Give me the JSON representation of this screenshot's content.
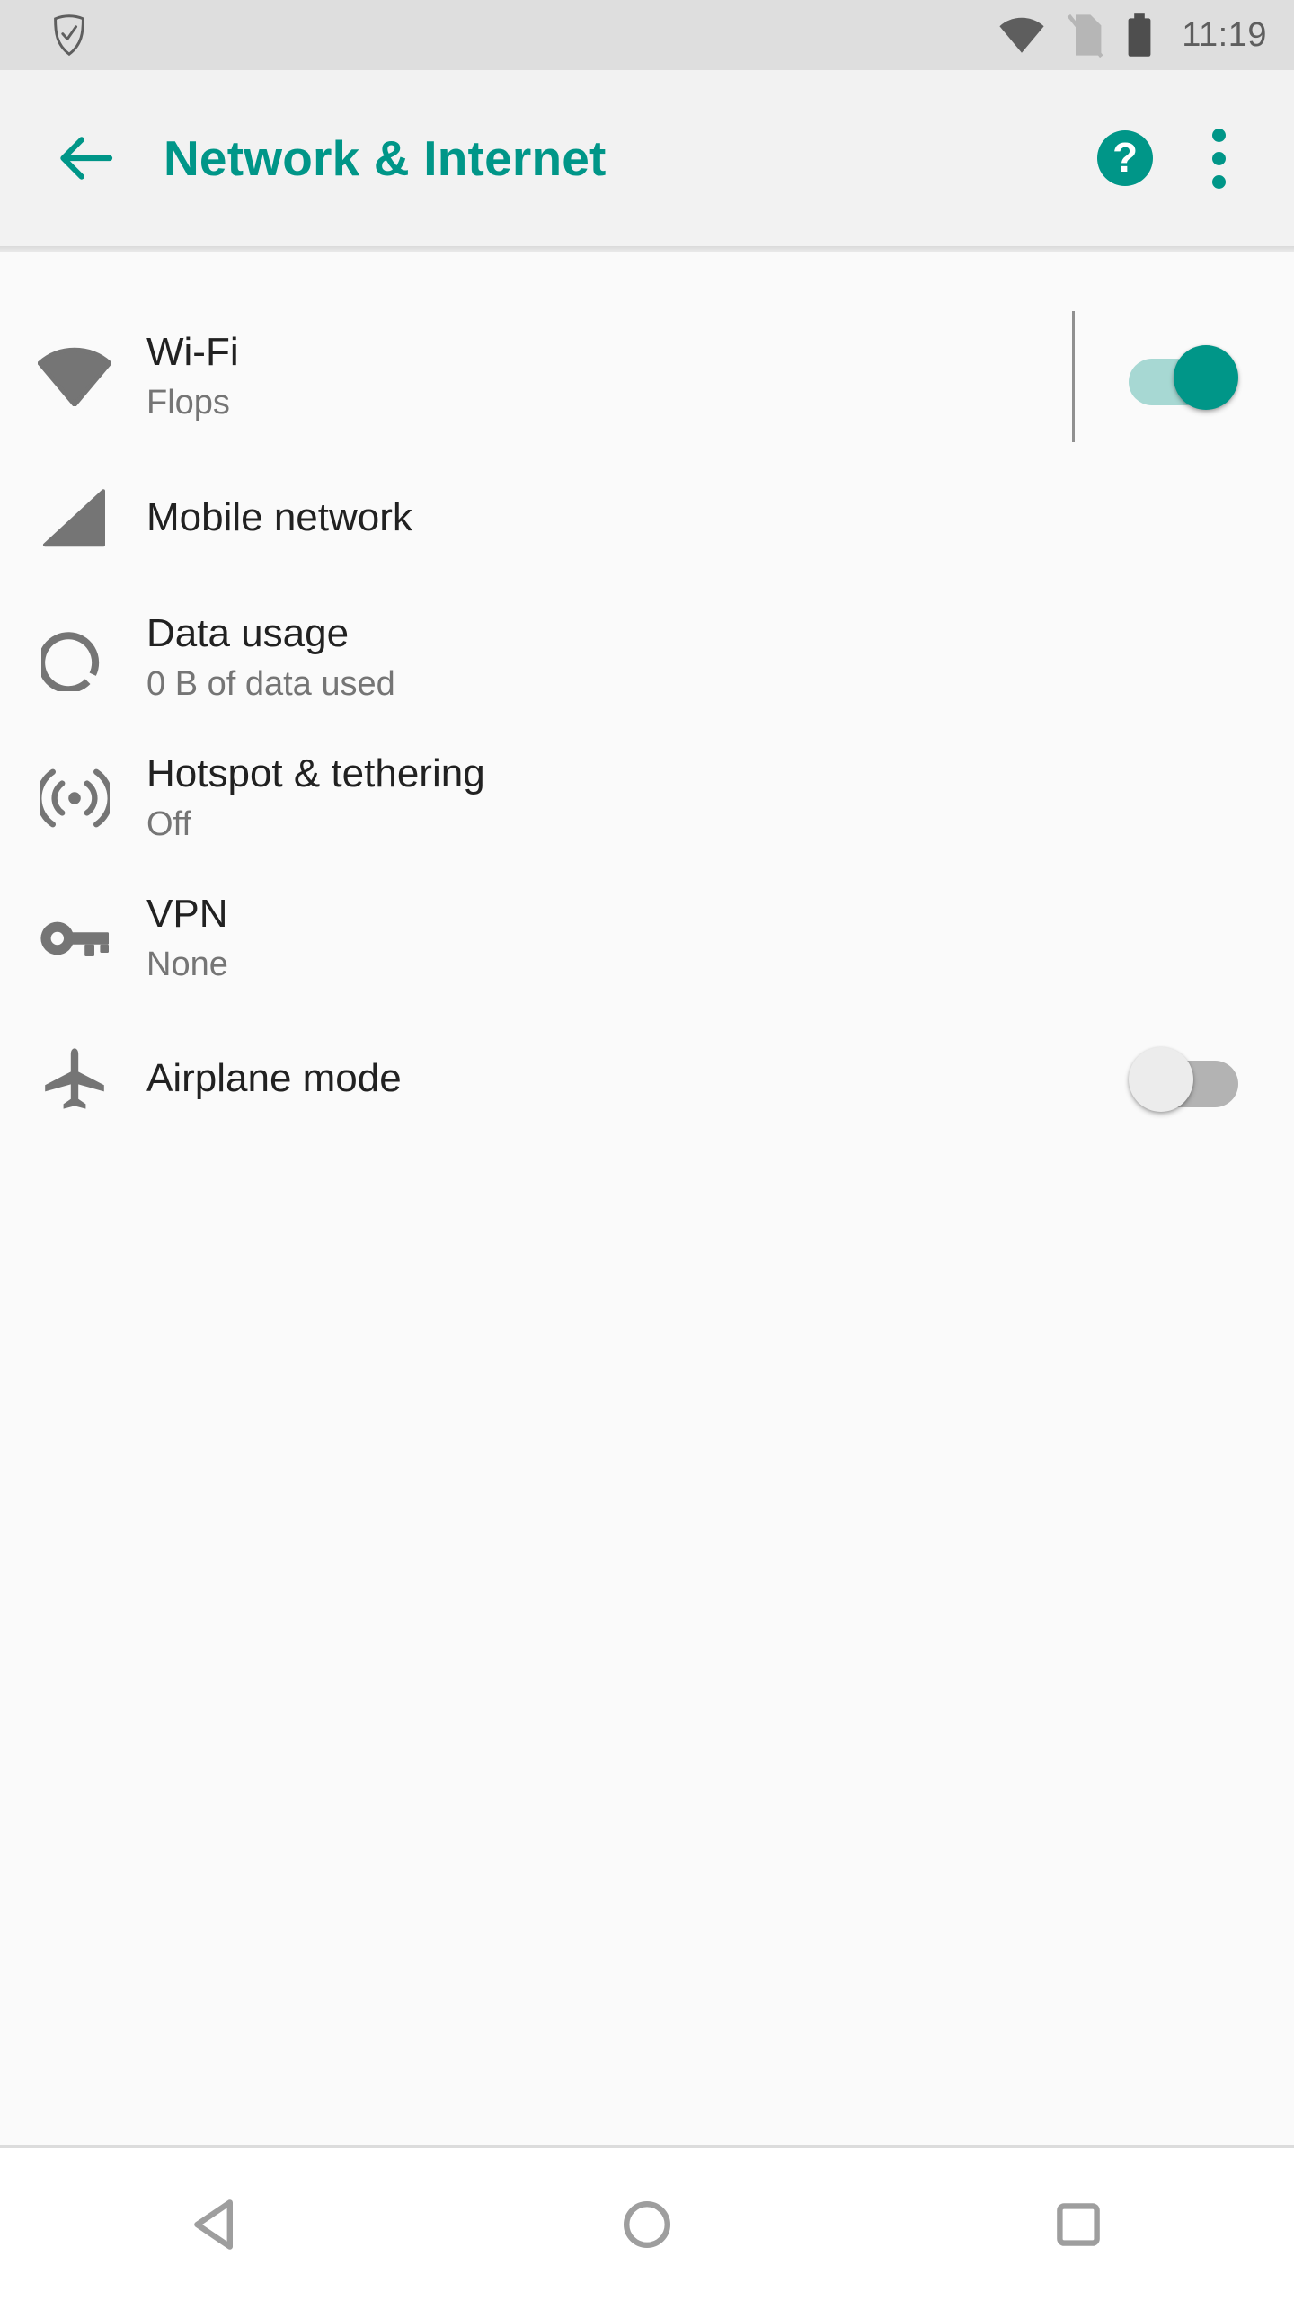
{
  "status_bar": {
    "left_icons": [
      {
        "name": "shield-check-icon",
        "label": "Security shield"
      }
    ],
    "right_icons": [
      {
        "name": "wifi-signal-icon",
        "label": "Wi-Fi signal"
      },
      {
        "name": "no-sim-icon",
        "label": "No SIM card"
      },
      {
        "name": "battery-full-icon",
        "label": "Battery full"
      }
    ],
    "time": "11:19",
    "background_color": "#dedede",
    "icon_color": "#5e5e5e"
  },
  "app_bar": {
    "back_label": "Navigate up",
    "title": "Network & Internet",
    "help_label": "?",
    "overflow_label": "More options",
    "accent_color": "#009688",
    "background_color": "#f2f2f2"
  },
  "settings": {
    "rows": [
      {
        "id": "wifi",
        "icon": "wifi-icon",
        "title": "Wi-Fi",
        "subtitle": "Flops",
        "has_divider": true,
        "switch": {
          "present": true,
          "state": "on"
        }
      },
      {
        "id": "mobile-network",
        "icon": "signal-cellular-icon",
        "title": "Mobile network",
        "subtitle": "",
        "has_divider": false,
        "switch": {
          "present": false,
          "state": ""
        }
      },
      {
        "id": "data-usage",
        "icon": "data-usage-donut-icon",
        "title": "Data usage",
        "subtitle": "0 B of data used",
        "has_divider": false,
        "switch": {
          "present": false,
          "state": ""
        }
      },
      {
        "id": "hotspot-tethering",
        "icon": "hotspot-icon",
        "title": "Hotspot & tethering",
        "subtitle": "Off",
        "has_divider": false,
        "switch": {
          "present": false,
          "state": ""
        }
      },
      {
        "id": "vpn",
        "icon": "key-icon",
        "title": "VPN",
        "subtitle": "None",
        "has_divider": false,
        "switch": {
          "present": false,
          "state": ""
        }
      },
      {
        "id": "airplane-mode",
        "icon": "airplane-icon",
        "title": "Airplane mode",
        "subtitle": "",
        "has_divider": false,
        "switch": {
          "present": true,
          "state": "off"
        }
      }
    ],
    "title_color": "#212121",
    "subtitle_color": "#757575",
    "icon_color": "#757575",
    "background_color": "#fafafa"
  },
  "nav_bar": {
    "buttons": [
      {
        "name": "nav-back-button",
        "icon": "triangle-left-icon",
        "label": "Back"
      },
      {
        "name": "nav-home-button",
        "icon": "circle-icon",
        "label": "Home"
      },
      {
        "name": "nav-recents-button",
        "icon": "square-icon",
        "label": "Recents"
      }
    ],
    "background_color": "#ffffff",
    "icon_color": "#9e9e9e"
  }
}
